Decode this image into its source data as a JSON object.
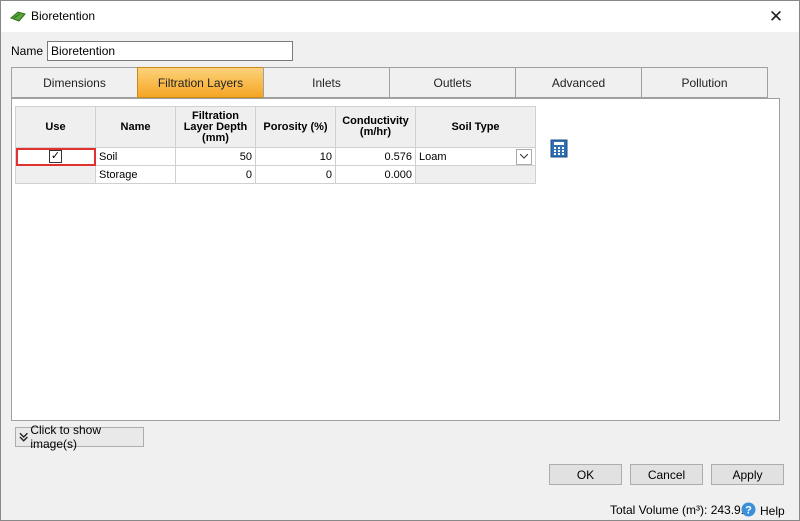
{
  "window": {
    "title": "Bioretention",
    "close_glyph": "✕"
  },
  "name_field": {
    "label": "Name",
    "value": "Bioretention"
  },
  "tabs": [
    {
      "label": "Dimensions",
      "active": false
    },
    {
      "label": "Filtration Layers",
      "active": true
    },
    {
      "label": "Inlets",
      "active": false
    },
    {
      "label": "Outlets",
      "active": false
    },
    {
      "label": "Advanced",
      "active": false
    },
    {
      "label": "Pollution",
      "active": false
    }
  ],
  "grid": {
    "headers": {
      "use": "Use",
      "name": "Name",
      "depth": "Filtration Layer Depth (mm)",
      "porosity": "Porosity (%)",
      "conductivity": "Conductivity (m/hr)",
      "soil_type": "Soil Type"
    },
    "rows": [
      {
        "use": true,
        "name": "Soil",
        "depth": "50",
        "porosity": "10",
        "conductivity": "0.576",
        "soil_type": "Loam"
      },
      {
        "use": null,
        "name": "Storage",
        "depth": "0",
        "porosity": "0",
        "conductivity": "0.000",
        "soil_type": ""
      }
    ]
  },
  "show_images_button": "Click to show image(s)",
  "buttons": {
    "ok": "OK",
    "cancel": "Cancel",
    "apply": "Apply"
  },
  "status": {
    "total_volume": "Total Volume (m³): 243.911",
    "help": "Help"
  },
  "colors": {
    "active_tab": "#f5a623",
    "selection_outline": "#e03030"
  }
}
